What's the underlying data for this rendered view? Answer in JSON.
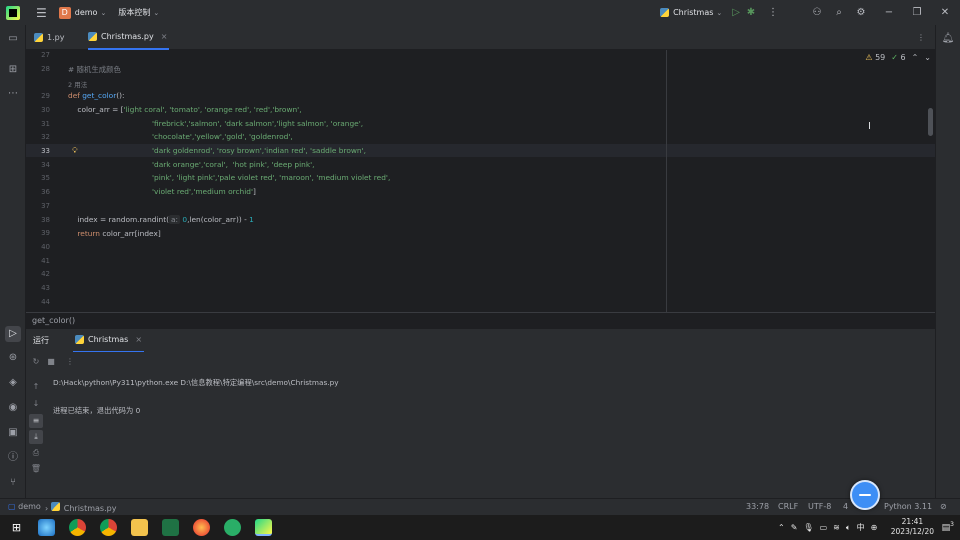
{
  "titlebar": {
    "project_badge": "D",
    "project_name": "demo",
    "vcs_label": "版本控制",
    "run_config": "Christmas"
  },
  "tabs": [
    {
      "label": "1.py"
    },
    {
      "label": "Christmas.py",
      "close": "×"
    }
  ],
  "editor": {
    "inspection": {
      "warnings": "59",
      "ok": "6"
    },
    "line_numbers": [
      "27",
      "28",
      "29",
      "30",
      "31",
      "32",
      "33",
      "34",
      "35",
      "36",
      "37",
      "38",
      "39",
      "40",
      "41",
      "42",
      "43",
      "44"
    ],
    "comment": "# 随机生成颜色",
    "usages": "2 用法",
    "def_kw": "def",
    "func_name": "get_color",
    "def_rest": "():",
    "line30_pre": "    color_arr = [",
    "line30_str": "'light coral', 'tomato', 'orange red', 'red','brown',",
    "line31": "'firebrick','salmon', 'dark salmon','light salmon', 'orange',",
    "line32": "'chocolate','yellow','gold', 'goldenrod',",
    "line33": "'dark goldenrod', 'rosy brown','indian red', 'saddle brown',",
    "line34": "'dark orange','coral',  'hot pink', 'deep pink',",
    "line35": "'pink', 'light pink','pale violet red', 'maroon', 'medium violet red',",
    "line36_str": "'violet red','medium orchid'",
    "line36_end": "]",
    "line38_pre": "    index = random.randint(",
    "line38_hint": "a:",
    "line38_num0": "0",
    "line38_mid": ",len(color_arr)) - ",
    "line38_num1": "1",
    "line39_kw": "    return",
    "line39_rest": " color_arr[index]"
  },
  "breadcrumb": "get_color()",
  "run_panel": {
    "title": "运行",
    "tab": "Christmas",
    "tab_close": "×",
    "command": "D:\\Hack\\python\\Py311\\python.exe D:\\信息教程\\特定编程\\src\\demo\\Christmas.py",
    "exit_message": "进程已结束，退出代码为 0"
  },
  "statusbar": {
    "project": "demo",
    "file": "Christmas.py",
    "position": "33:78",
    "line_sep": "CRLF",
    "encoding": "UTF-8",
    "indent": "4",
    "interpreter": "Python 3.11"
  },
  "taskbar": {
    "ime": "中",
    "time": "21:41",
    "date": "2023/12/20",
    "notifications": "3"
  },
  "colors": {
    "accent": "#3574f0",
    "keyword": "#cf8e6d",
    "function": "#56a8f5",
    "string": "#6aab73",
    "number": "#2aacb8",
    "run_green": "#57965c"
  }
}
